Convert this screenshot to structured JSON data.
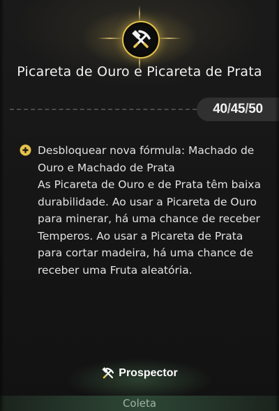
{
  "header": {
    "icon": "crossed-pickaxe-hammer-icon",
    "title": "Picareta de Ouro e Picareta de Prata",
    "accent_color": "#e5c24a"
  },
  "level": {
    "values": [
      "40",
      "45",
      "50"
    ],
    "separator": "/"
  },
  "description": {
    "icon": "plus-circle-icon",
    "text": "Desbloquear nova fórmula: Machado de Ouro e Machado de Prata\nAs Picareta de Ouro e de Prata têm baixa durabilidade. Ao usar a Picareta de Ouro para minerar, há uma chance de receber Temperos. Ao usar a Picareta de Prata para cortar madeira, há uma chance de receber uma Fruta aleatória."
  },
  "footer": {
    "icon": "pickaxe-hammer-icon",
    "label": "Prospector",
    "category": "Coleta"
  }
}
